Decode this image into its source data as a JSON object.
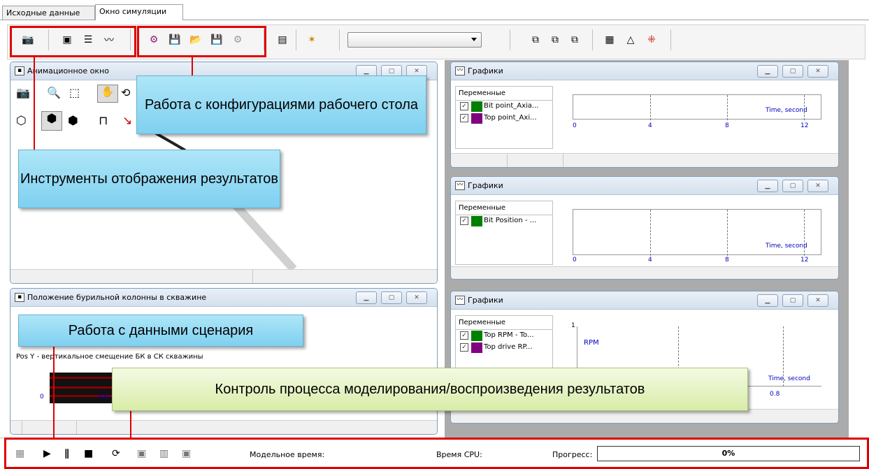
{
  "tabs": [
    {
      "label": "Исходные данные"
    },
    {
      "label": "Окно симуляции"
    }
  ],
  "toolbar": {
    "combo_value": "",
    "icons": [
      "camera-icon",
      "new-animation-window-icon",
      "list-icon",
      "new-graph-window-icon",
      "config-settings-icon",
      "save-config-icon",
      "open-config-icon",
      "save-desktop-icon",
      "desktop-config-icon",
      "report-icon",
      "wizard-icon",
      "cascade-windows-icon",
      "close-windows-icon",
      "tile-windows-icon",
      "table-icon",
      "histogram-icon",
      "layout-icon"
    ]
  },
  "windows": {
    "animation": {
      "title": "Анимационное окно"
    },
    "position": {
      "title": "Положение бурильной колонны в скважине",
      "subtitle": "Pos Y - вертикальное смещение БК в СК скважины",
      "tick0": "0",
      "tick1": "100"
    },
    "graph1": {
      "title": "Графики",
      "vars_header": "Переменные",
      "vars": [
        {
          "name": "Bit point_Axia...",
          "color": "#008000"
        },
        {
          "name": "Top point_Axi...",
          "color": "#800080"
        }
      ],
      "xlabel": "Time, second",
      "xticks": [
        "0",
        "4",
        "8",
        "12"
      ]
    },
    "graph2": {
      "title": "Графики",
      "vars_header": "Переменные",
      "vars": [
        {
          "name": "Bit Position - ...",
          "color": "#008000"
        }
      ],
      "xlabel": "Time, second",
      "xticks": [
        "0",
        "4",
        "8",
        "12"
      ]
    },
    "graph3": {
      "title": "Графики",
      "vars_header": "Переменные",
      "vars": [
        {
          "name": "Top RPM - To...",
          "color": "#008000"
        },
        {
          "name": "Top drive RP...",
          "color": "#800080"
        }
      ],
      "ylabel": "RPM",
      "ytick": "1",
      "xlabel": "Time, second",
      "xtick": "0.8"
    }
  },
  "callouts": {
    "config": "Работа с конфигурациями рабочего стола",
    "tools": "Инструменты отображения результатов",
    "scenario": "Работа с данными сценария",
    "control": "Контроль процесса моделирования/воспроизведения результатов"
  },
  "bottom": {
    "model_time_label": "Модельное время:",
    "cpu_time_label": "Время CPU:",
    "progress_label": "Прогресс:",
    "progress_value": "0%",
    "progress_fraction": 0
  },
  "colors": {
    "highlight_red": "#e00000",
    "callout_blue": "#8fd6f2",
    "callout_green": "#e4f2c4"
  }
}
